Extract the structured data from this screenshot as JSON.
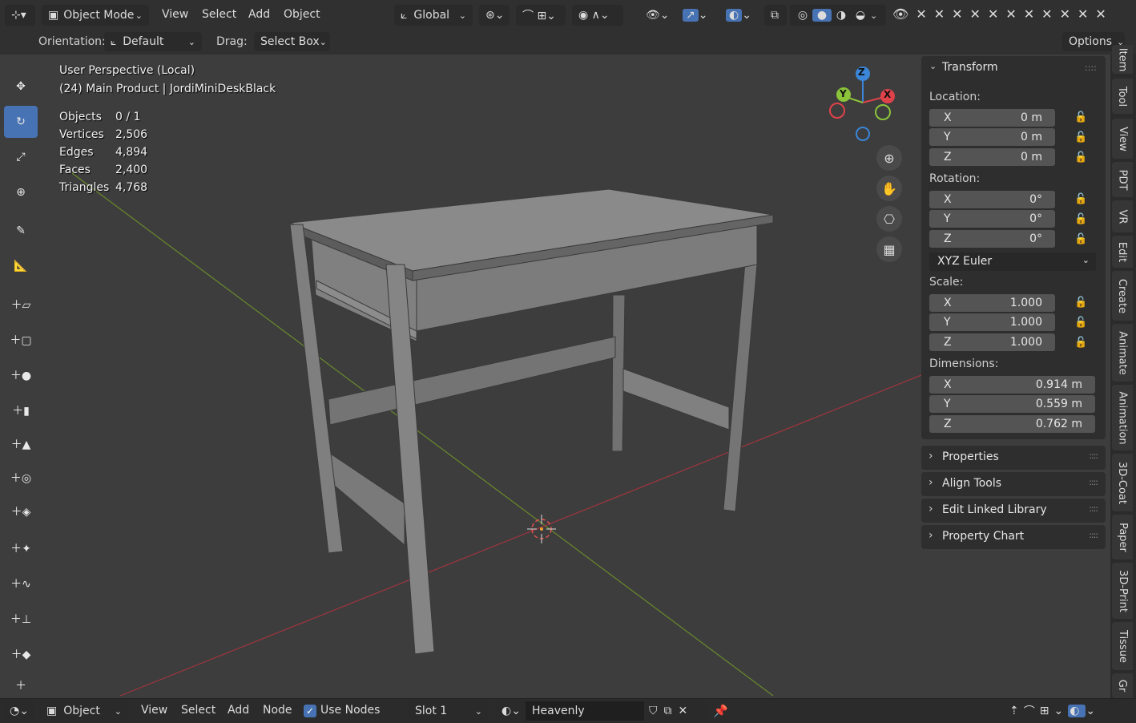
{
  "header": {
    "mode": "Object Mode",
    "menus": [
      "View",
      "Select",
      "Add",
      "Object"
    ],
    "transform_orientation": "Global"
  },
  "tool_settings": {
    "orientation_label": "Orientation:",
    "orientation_value": "Default",
    "drag_label": "Drag:",
    "drag_value": "Select Box",
    "options": "Options"
  },
  "viewport": {
    "perspective": "User Perspective (Local)",
    "collection": "(24) Main Product | JordiMiniDeskBlack",
    "stats": [
      {
        "label": "Objects",
        "value": "0 / 1"
      },
      {
        "label": "Vertices",
        "value": "2,506"
      },
      {
        "label": "Edges",
        "value": "4,894"
      },
      {
        "label": "Faces",
        "value": "2,400"
      },
      {
        "label": "Triangles",
        "value": "4,768"
      }
    ],
    "gizmo": {
      "x": "X",
      "y": "Y",
      "z": "Z"
    }
  },
  "npanel": {
    "transform_title": "Transform",
    "location_label": "Location:",
    "location": [
      {
        "axis": "X",
        "value": "0 m"
      },
      {
        "axis": "Y",
        "value": "0 m"
      },
      {
        "axis": "Z",
        "value": "0 m"
      }
    ],
    "rotation_label": "Rotation:",
    "rotation": [
      {
        "axis": "X",
        "value": "0°"
      },
      {
        "axis": "Y",
        "value": "0°"
      },
      {
        "axis": "Z",
        "value": "0°"
      }
    ],
    "rotation_mode": "XYZ Euler",
    "scale_label": "Scale:",
    "scale": [
      {
        "axis": "X",
        "value": "1.000"
      },
      {
        "axis": "Y",
        "value": "1.000"
      },
      {
        "axis": "Z",
        "value": "1.000"
      }
    ],
    "dimensions_label": "Dimensions:",
    "dimensions": [
      {
        "axis": "X",
        "value": "0.914 m"
      },
      {
        "axis": "Y",
        "value": "0.559 m"
      },
      {
        "axis": "Z",
        "value": "0.762 m"
      }
    ],
    "collapsed_panels": [
      "Properties",
      "Align Tools",
      "Edit Linked Library",
      "Property Chart"
    ]
  },
  "sidebar_tabs": [
    "Item",
    "Tool",
    "View",
    "PDT",
    "VR",
    "Edit",
    "Create",
    "Animate",
    "Animation",
    "3D-Coat",
    "Paper",
    "3D-Print",
    "Tissue",
    "Gr"
  ],
  "bottom": {
    "mode": "Object",
    "menus": [
      "View",
      "Select",
      "Add",
      "Node"
    ],
    "use_nodes": "Use Nodes",
    "slot": "Slot 1",
    "material": "Heavenly"
  },
  "colors": {
    "active": "#4772b3",
    "x_axis": "#e0424a",
    "y_axis": "#8bc43a",
    "z_axis": "#3b86d8"
  }
}
